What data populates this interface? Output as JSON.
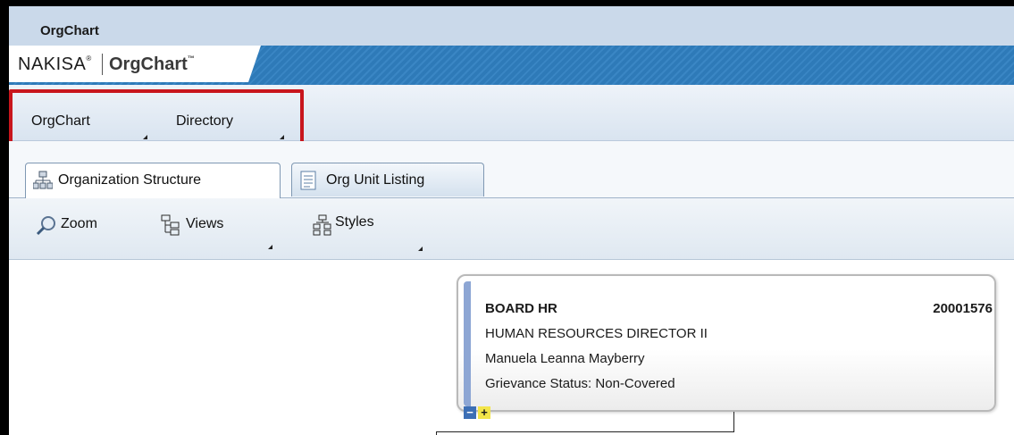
{
  "window": {
    "title": "OrgChart"
  },
  "brand": {
    "name": "NAKISA",
    "product": "OrgChart",
    "reg_mark": "®",
    "tm_mark": "™"
  },
  "menu": {
    "items": [
      {
        "label": "OrgChart"
      },
      {
        "label": "Directory"
      }
    ]
  },
  "tabs": [
    {
      "label": "Organization Structure",
      "icon": "org-structure-icon",
      "active": true
    },
    {
      "label": "Org Unit Listing",
      "icon": "document-list-icon",
      "active": false
    }
  ],
  "toolbar": {
    "zoom_label": "Zoom",
    "views_label": "Views",
    "styles_label": "Styles"
  },
  "card": {
    "name": "BOARD HR",
    "id": "20001576",
    "title": "HUMAN RESOURCES DIRECTOR II",
    "person": "Manuela Leanna Mayberry",
    "status": "Grievance Status: Non-Covered",
    "collapse": "−",
    "expand": "+"
  },
  "colors": {
    "highlight": "#c8161d",
    "brand_bar": "#2e7ab8",
    "card_accent": "#8da6d4"
  }
}
